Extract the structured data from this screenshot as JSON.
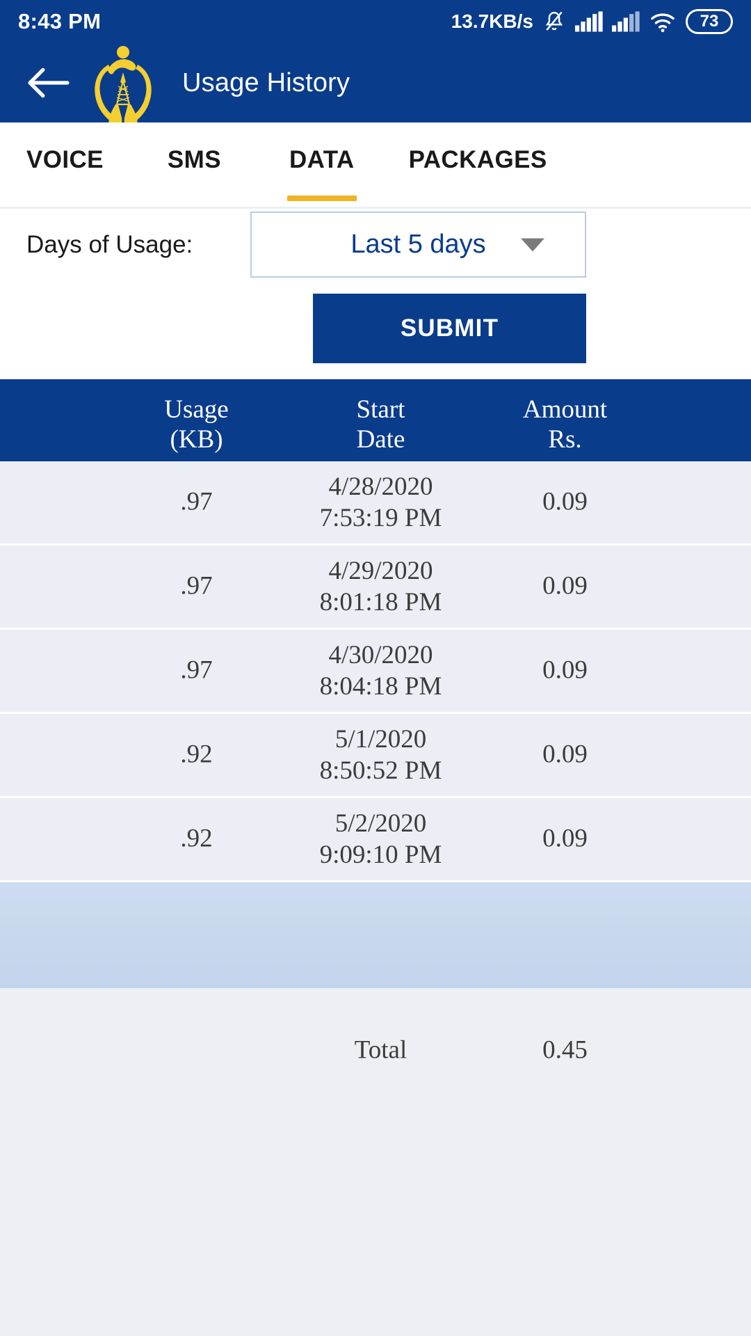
{
  "statusbar": {
    "time": "8:43 PM",
    "network_speed": "13.7KB/s",
    "battery_level": "73",
    "icons": [
      "bell-muted-icon",
      "signal-sim1-icon",
      "signal-sim2-icon",
      "wifi-icon",
      "battery-icon"
    ]
  },
  "appbar": {
    "back_icon": "back-arrow-icon",
    "logo_icon": "telecom-logo-icon",
    "title": "Usage History"
  },
  "tabs": [
    {
      "label": "VOICE",
      "active": false
    },
    {
      "label": "SMS",
      "active": false
    },
    {
      "label": "DATA",
      "active": true
    },
    {
      "label": "PACKAGES",
      "active": false
    }
  ],
  "filter": {
    "label": "Days of Usage:",
    "selected": "Last 5 days",
    "caret_icon": "chevron-down-icon"
  },
  "submit": {
    "label": "SUBMIT"
  },
  "table": {
    "headers": {
      "usage": "Usage\n(KB)",
      "usage_line1": "Usage",
      "usage_line2": "(KB)",
      "date_line1": "Start",
      "date_line2": "Date",
      "amount_line1": "Amount",
      "amount_line2": "Rs."
    },
    "rows": [
      {
        "usage": ".97",
        "date": "4/28/2020",
        "time": "7:53:19 PM",
        "amount": "0.09"
      },
      {
        "usage": ".97",
        "date": "4/29/2020",
        "time": "8:01:18 PM",
        "amount": "0.09"
      },
      {
        "usage": ".97",
        "date": "4/30/2020",
        "time": "8:04:18 PM",
        "amount": "0.09"
      },
      {
        "usage": ".92",
        "date": "5/1/2020",
        "time": "8:50:52 PM",
        "amount": "0.09"
      },
      {
        "usage": ".92",
        "date": "5/2/2020",
        "time": "9:09:10 PM",
        "amount": "0.09"
      }
    ],
    "total": {
      "label": "Total",
      "amount": "0.45"
    }
  },
  "colors": {
    "brand_blue": "#0a3c8c",
    "accent_yellow": "#f0b323",
    "row_bg": "#ebeef4",
    "band_blue": "#c6d7ee"
  }
}
